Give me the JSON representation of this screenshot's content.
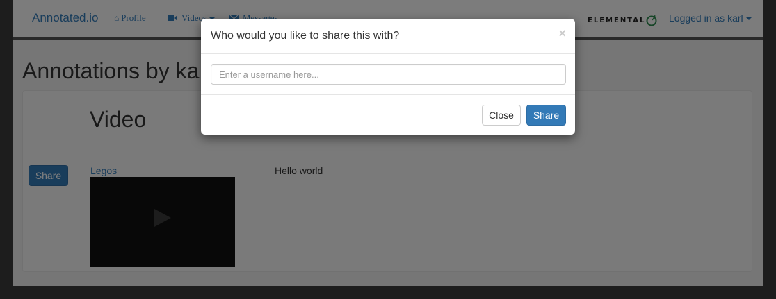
{
  "navbar": {
    "brand": "Annotated.io",
    "profile_label": "Profile",
    "videos_label": "Videos",
    "messages_label": "Messages",
    "logo_text": "ELEMENTAL",
    "user_label": "Logged in as karl",
    "icons": {
      "profile": "home-icon",
      "videos": "video-camera-icon",
      "messages": "envelope-icon"
    }
  },
  "page": {
    "title": "Annotations by ka",
    "video_heading": "Video",
    "share_button": "Share",
    "video_title": "Legos",
    "annotation": "Hello world"
  },
  "modal": {
    "title": "Who would you like to share this with?",
    "close_symbol": "×",
    "input_placeholder": "Enter a username here...",
    "input_value": "",
    "close_button": "Close",
    "share_button": "Share"
  },
  "colors": {
    "accent": "#337ab7",
    "backdrop": "#000000"
  }
}
